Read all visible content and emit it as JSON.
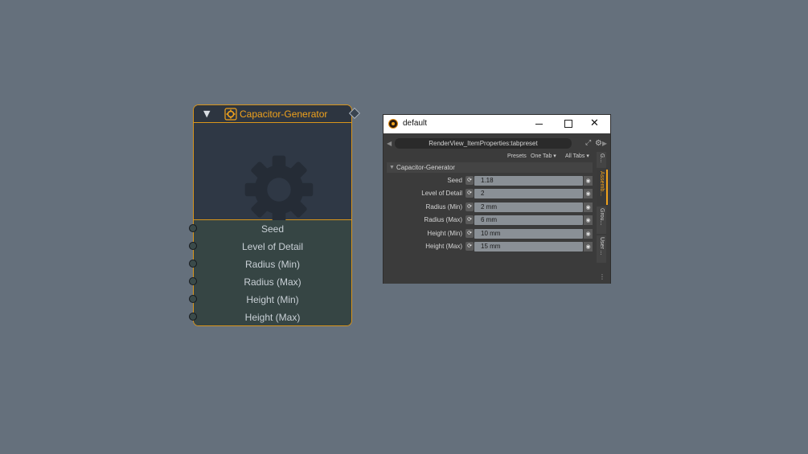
{
  "colors": {
    "background": "#65707c",
    "accent": "#f0a21c",
    "node_border": "#d9951c",
    "node_inputs_bg": "#364544",
    "panel_bg": "#3b3b3b",
    "field_bg": "#8a9096"
  },
  "node": {
    "collapse_icon": "triangle-down",
    "title_icon": "gear-icon",
    "title": "Capacitor-Generator",
    "preview_icon": "gear-icon",
    "inputs": [
      {
        "label": "Seed"
      },
      {
        "label": "Level of Detail"
      },
      {
        "label": "Radius (Min)"
      },
      {
        "label": "Radius (Max)"
      },
      {
        "label": "Height (Min)"
      },
      {
        "label": "Height (Max)"
      }
    ]
  },
  "window": {
    "title": "default",
    "tab_preset": "RenderView_ItemProperties:tabpreset",
    "presets_label": "Presets",
    "one_tab_label": "One Tab",
    "all_tabs_label": "All Tabs",
    "group_title": "Capacitor-Generator",
    "properties": [
      {
        "label": "Seed",
        "value": "1.18"
      },
      {
        "label": "Level of Detail",
        "value": "2"
      },
      {
        "label": "Radius (Min)",
        "value": "2 mm"
      },
      {
        "label": "Radius (Max)",
        "value": "6 mm"
      },
      {
        "label": "Height (Min)",
        "value": "10 mm"
      },
      {
        "label": "Height (Max)",
        "value": "15 mm"
      }
    ],
    "side_tabs": [
      {
        "label": "G...",
        "active": false
      },
      {
        "label": "Assemb...",
        "active": true
      },
      {
        "label": "Grou...",
        "active": false
      },
      {
        "label": "User ...",
        "active": false
      }
    ],
    "side_more": "⋮"
  }
}
